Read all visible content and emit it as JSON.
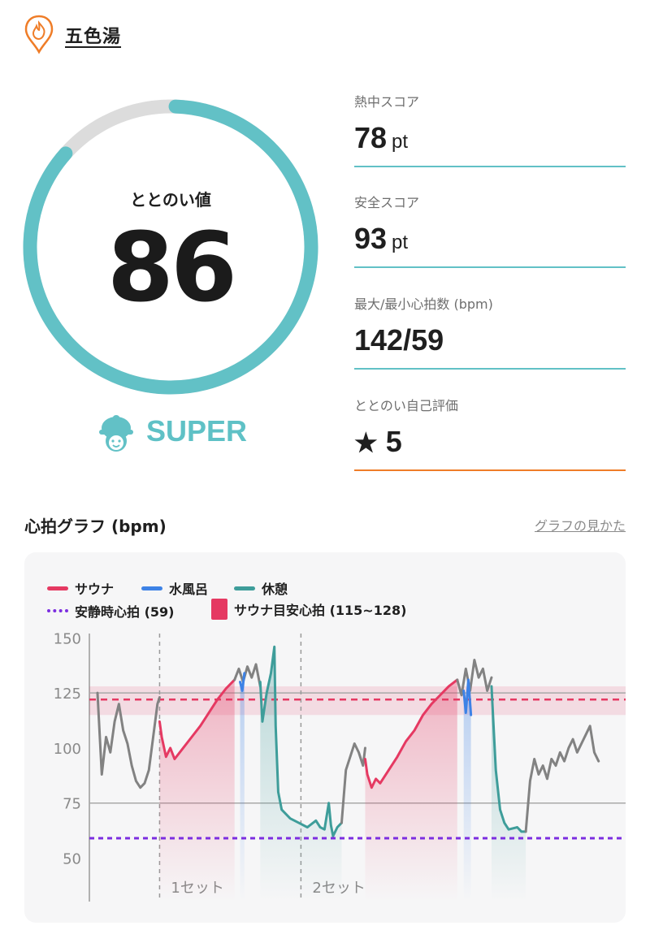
{
  "header": {
    "facility_name": "五色湯"
  },
  "totonoi": {
    "label": "ととのい値",
    "value": "86",
    "score": 86,
    "max": 100,
    "rank": "SUPER"
  },
  "metrics": [
    {
      "label": "熱中スコア",
      "value": "78",
      "unit": "pt"
    },
    {
      "label": "安全スコア",
      "value": "93",
      "unit": "pt"
    },
    {
      "label": "最大/最小心拍数 (bpm)",
      "value": "142/59",
      "unit": ""
    },
    {
      "label": "ととのい自己評価",
      "value": "5",
      "unit": ""
    }
  ],
  "chart_section": {
    "title": "心拍グラフ (bpm)",
    "guide_link": "グラフの見かた"
  },
  "colors": {
    "accent": "#62c1c6",
    "sauna": "#e53962",
    "water": "#3d82e6",
    "rest": "#3e9d9a",
    "rest_line": "#7c2ee0",
    "other": "#828282",
    "self_eval_line": "#ef7d28"
  },
  "chart_data": {
    "type": "line",
    "ylim": [
      45,
      152
    ],
    "yticks": [
      "150",
      "125",
      "100",
      "75",
      "50"
    ],
    "ytick_values": [
      150,
      125,
      100,
      75,
      50
    ],
    "xlim": [
      0,
      100
    ],
    "set_dividers": [
      {
        "x": 14.5,
        "label": "1セット"
      },
      {
        "x": 47.5,
        "label": "2セット"
      }
    ],
    "reference_lines": {
      "resting": 59,
      "target_low": 115,
      "target_high": 128,
      "target_mid": 122,
      "gray_lines": [
        125,
        75
      ]
    },
    "legend": {
      "sauna": "サウナ",
      "water": "水風呂",
      "rest": "休憩",
      "resting": "安静時心拍 (59)",
      "target": "サウナ目安心拍 (115~128)"
    },
    "series": [
      {
        "name": "gray",
        "color": "#828282",
        "points": [
          [
            0,
            125
          ],
          [
            1,
            88
          ],
          [
            2,
            105
          ],
          [
            3,
            98
          ],
          [
            4,
            112
          ],
          [
            5,
            120
          ],
          [
            6,
            108
          ],
          [
            7,
            102
          ],
          [
            8,
            92
          ],
          [
            9,
            85
          ],
          [
            10,
            82
          ],
          [
            11,
            84
          ],
          [
            12,
            90
          ],
          [
            13,
            105
          ],
          [
            14,
            120
          ],
          [
            14.5,
            123
          ]
        ]
      },
      {
        "name": "サウナ",
        "color": "#e53962",
        "points": [
          [
            14.5,
            112
          ],
          [
            15,
            105
          ],
          [
            16,
            96
          ],
          [
            17,
            100
          ],
          [
            18,
            95
          ],
          [
            20,
            100
          ],
          [
            22,
            105
          ],
          [
            24,
            110
          ],
          [
            26,
            116
          ],
          [
            28,
            122
          ],
          [
            30,
            127
          ],
          [
            32,
            131
          ]
        ]
      },
      {
        "name": "gray",
        "color": "#828282",
        "points": [
          [
            32,
            131
          ],
          [
            33,
            136
          ],
          [
            34,
            130
          ],
          [
            35,
            137
          ],
          [
            36,
            132
          ],
          [
            37,
            138
          ],
          [
            38,
            128
          ]
        ]
      },
      {
        "name": "水風呂",
        "color": "#3d82e6",
        "points": [
          [
            33.3,
            130
          ],
          [
            33.8,
            126
          ],
          [
            34.3,
            134
          ]
        ]
      },
      {
        "name": "休憩",
        "color": "#3e9d9a",
        "points": [
          [
            38,
            130
          ],
          [
            38.5,
            112
          ],
          [
            39.5,
            125
          ],
          [
            40.5,
            134
          ],
          [
            41.3,
            146
          ],
          [
            41.6,
            110
          ],
          [
            42.2,
            80
          ],
          [
            43,
            72
          ],
          [
            45,
            68
          ],
          [
            47,
            66
          ],
          [
            49,
            64
          ],
          [
            51,
            67
          ],
          [
            52,
            64
          ],
          [
            53,
            63
          ],
          [
            54,
            75
          ],
          [
            54.5,
            65
          ],
          [
            55,
            60
          ],
          [
            56,
            64
          ],
          [
            57,
            66
          ]
        ]
      },
      {
        "name": "gray",
        "color": "#828282",
        "points": [
          [
            57,
            66
          ],
          [
            57.5,
            78
          ],
          [
            58,
            90
          ],
          [
            59,
            96
          ],
          [
            60,
            102
          ],
          [
            61,
            98
          ],
          [
            62,
            92
          ],
          [
            62.5,
            100
          ]
        ]
      },
      {
        "name": "サウナ",
        "color": "#e53962",
        "points": [
          [
            62.5,
            95
          ],
          [
            63,
            88
          ],
          [
            64,
            82
          ],
          [
            65,
            86
          ],
          [
            66,
            84
          ],
          [
            68,
            90
          ],
          [
            70,
            96
          ],
          [
            72,
            103
          ],
          [
            74,
            108
          ],
          [
            76,
            115
          ],
          [
            78,
            120
          ],
          [
            80,
            124
          ],
          [
            82,
            128
          ],
          [
            84,
            131
          ]
        ]
      },
      {
        "name": "gray",
        "color": "#828282",
        "points": [
          [
            84,
            131
          ],
          [
            85,
            124
          ],
          [
            86,
            136
          ],
          [
            87,
            126
          ],
          [
            88,
            140
          ],
          [
            89,
            132
          ],
          [
            90,
            136
          ],
          [
            91,
            126
          ],
          [
            92,
            132
          ]
        ]
      },
      {
        "name": "水風呂",
        "color": "#3d82e6",
        "points": [
          [
            85.5,
            126
          ],
          [
            86,
            116
          ],
          [
            86.6,
            131
          ],
          [
            87.2,
            115
          ]
        ]
      },
      {
        "name": "休憩",
        "color": "#3e9d9a",
        "points": [
          [
            92,
            128
          ],
          [
            93,
            90
          ],
          [
            94,
            72
          ],
          [
            95,
            66
          ],
          [
            96,
            63
          ],
          [
            98,
            64
          ],
          [
            99,
            62
          ],
          [
            100,
            62
          ]
        ]
      },
      {
        "name": "gray",
        "color": "#828282",
        "points": [
          [
            100,
            62
          ],
          [
            101,
            85
          ],
          [
            102,
            95
          ],
          [
            103,
            88
          ],
          [
            104,
            92
          ],
          [
            105,
            86
          ],
          [
            106,
            95
          ],
          [
            107,
            92
          ],
          [
            108,
            98
          ],
          [
            109,
            94
          ],
          [
            110,
            100
          ],
          [
            111,
            104
          ],
          [
            112,
            98
          ],
          [
            113,
            102
          ],
          [
            114,
            106
          ],
          [
            115,
            110
          ],
          [
            116,
            98
          ],
          [
            117,
            94
          ]
        ]
      }
    ],
    "fills": [
      {
        "color": "#e53962",
        "x": [
          14.5,
          32
        ]
      },
      {
        "color": "#3d82e6",
        "x": [
          33.3,
          34.5
        ]
      },
      {
        "color": "#3e9d9a",
        "x": [
          38,
          57
        ]
      },
      {
        "color": "#e53962",
        "x": [
          62.5,
          84
        ]
      },
      {
        "color": "#3d82e6",
        "x": [
          85.5,
          87.2
        ]
      },
      {
        "color": "#3e9d9a",
        "x": [
          92,
          100
        ]
      }
    ]
  }
}
